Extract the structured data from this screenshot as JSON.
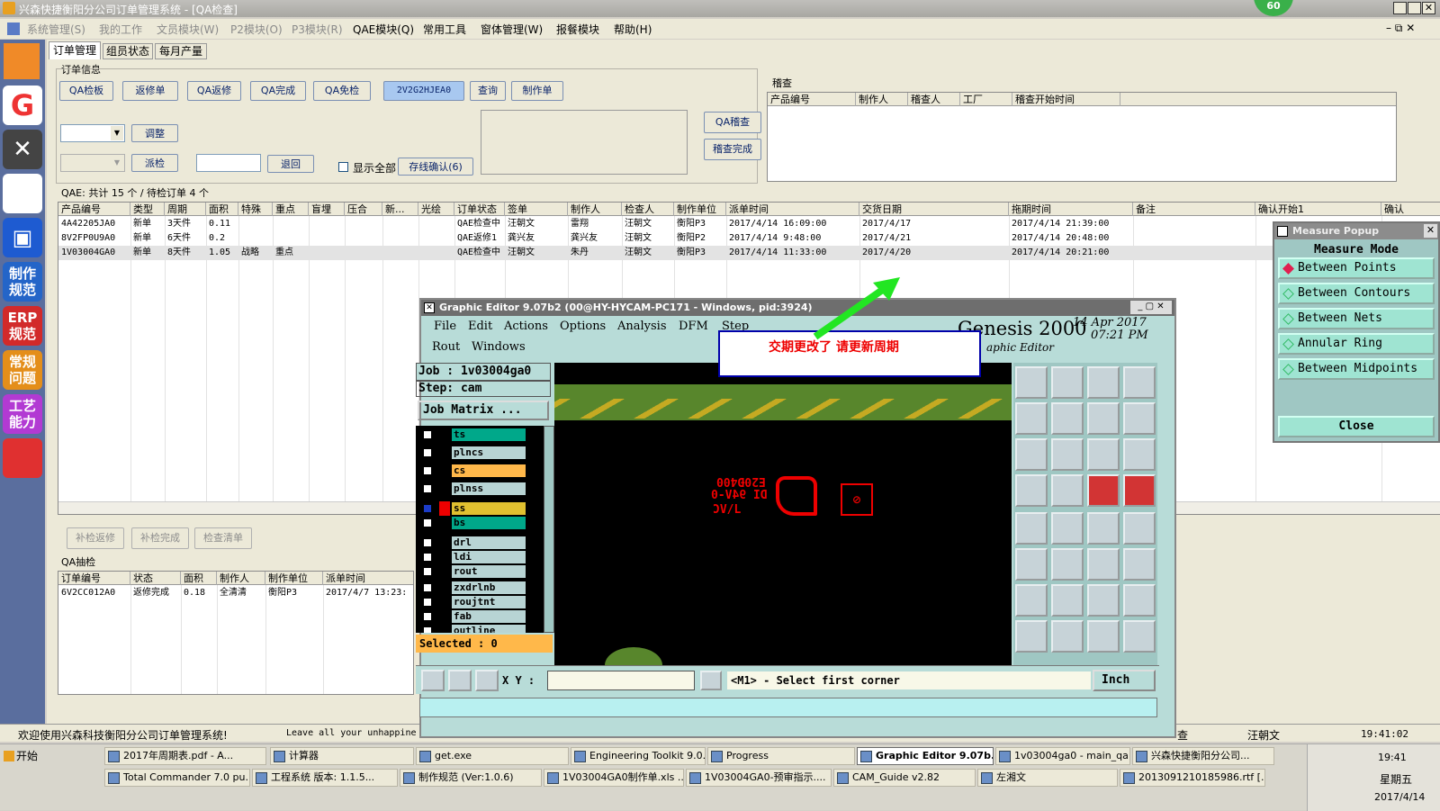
{
  "window": {
    "title": "兴森快捷衡阳分公司订单管理系统 - [QA检查]",
    "badge": "60"
  },
  "menubar": [
    "系统管理(S)",
    "我的工作",
    "文员模块(W)",
    "P2模块(O)",
    "P3模块(R)",
    "QAE模块(Q)",
    "常用工具",
    "窗体管理(W)",
    "报餐模块",
    "帮助(H)"
  ],
  "sidebar": {
    "labels": [
      "制作\n规范",
      "ERP\n规范",
      "常规\n问题",
      "工艺\n能力"
    ]
  },
  "tabs": [
    "订单管理",
    "组员状态",
    "每月产量"
  ],
  "order_info": {
    "group_label": "订单信息",
    "buttons_row1": [
      "QA检板",
      "返修单",
      "QA返修",
      "QA完成",
      "QA免检",
      "2V2G2HJEA0",
      "查询",
      "制作单"
    ],
    "adjust": "调整",
    "dispatch": "派检",
    "back": "退回",
    "show_all": "显示全部",
    "confirm": "存线确认(6)",
    "qa_audit": "QA稽查",
    "audit_done": "稽查完成"
  },
  "audit": {
    "label": "稽查",
    "headers": [
      "产品编号",
      "制作人",
      "稽查人",
      "工厂",
      "稽查开始时间"
    ]
  },
  "qae": {
    "summary": "QAE: 共计 15 个 / 待检订单 4 个",
    "headers": [
      "产品编号",
      "类型",
      "周期",
      "面积",
      "特殊",
      "重点",
      "盲埋",
      "压合",
      "新...",
      "光绘",
      "订单状态",
      "签单",
      "制作人",
      "检查人",
      "制作单位",
      "派单时间",
      "交货日期",
      "拖期时间",
      "备注",
      "确认开始1",
      "确认"
    ],
    "rows": [
      [
        "4A42205JA0",
        "新单",
        "3天件",
        "0.11",
        "",
        "",
        "",
        "",
        "",
        "",
        "QAE检查中",
        "汪朝文",
        "雷翔",
        "汪朝文",
        "衡阳P3",
        "2017/4/14 16:09:00",
        "2017/4/17",
        "2017/4/14 21:39:00",
        "",
        "",
        ""
      ],
      [
        "8V2FP0U9A0",
        "新单",
        "6天件",
        "0.2",
        "",
        "",
        "",
        "",
        "",
        "",
        "QAE返修1",
        "龚兴友",
        "龚兴友",
        "汪朝文",
        "衡阳P2",
        "2017/4/14 9:48:00",
        "2017/4/21",
        "2017/4/14 20:48:00",
        "",
        "",
        ""
      ],
      [
        "1V03004GA0",
        "新单",
        "8天件",
        "1.05",
        "战略",
        "重点",
        "",
        "",
        "",
        "",
        "QAE检查中",
        "汪朝文",
        "朱丹",
        "汪朝文",
        "衡阳P3",
        "2017/4/14 11:33:00",
        "2017/4/20",
        "2017/4/14 20:21:00",
        "",
        "",
        ""
      ]
    ]
  },
  "bottom": {
    "buttons": [
      "补检返修",
      "补检完成",
      "检查清单"
    ],
    "group_label": "QA抽检",
    "headers": [
      "订单编号",
      "状态",
      "面积",
      "制作人",
      "制作单位",
      "派单时间"
    ],
    "rows": [
      [
        "6V2CC012A0",
        "返修完成",
        "0.18",
        "全清清",
        "衡阳P3",
        "2017/4/7 13:23:"
      ]
    ]
  },
  "status": {
    "welcome": "欢迎使用兴森科技衡阳分公司订单管理系统!",
    "message": "Leave all your unhappine",
    "extra": "查",
    "user": "汪朝文",
    "time": "19:41:02"
  },
  "graphic_editor": {
    "title": "Graphic Editor 9.07b2 (00@HY-HYCAM-PC171 - Windows, pid:3924)",
    "menu": [
      "File",
      "Edit",
      "Actions",
      "Options",
      "Analysis",
      "DFM",
      "Step",
      "Rout",
      "Windows"
    ],
    "brand": "Genesis 2000",
    "date": "14 Apr  2017",
    "time": "07:21 PM",
    "sub": "aphic Editor",
    "job": "Job : 1v03004ga0",
    "step": "Step: cam",
    "job_matrix": "Job Matrix ...",
    "layers": [
      {
        "name": "ts",
        "color": "#00a88a"
      },
      {
        "name": "plncs",
        "color": "#b8d4d4"
      },
      {
        "name": "cs",
        "color": "#ffb84a"
      },
      {
        "name": "plnss",
        "color": "#b8d4d4"
      },
      {
        "name": "ss",
        "color": "#e0c030"
      },
      {
        "name": "bs",
        "color": "#00a88a"
      },
      {
        "name": "drl",
        "color": "#b8d4d4"
      },
      {
        "name": "ldi",
        "color": "#b8d4d4"
      },
      {
        "name": "rout",
        "color": "#b8d4d4"
      },
      {
        "name": "zxdrlnb",
        "color": "#b8d4d4"
      },
      {
        "name": "roujtnt",
        "color": "#b8d4d4"
      },
      {
        "name": "fab",
        "color": "#b8d4d4"
      },
      {
        "name": "outline",
        "color": "#b8d4d4"
      }
    ],
    "selected": "Selected : 0",
    "xy_label": "X Y :",
    "prompt": "<M1> - Select first corner",
    "unit": "Inch",
    "board_text1": "E20Ð400",
    "board_text2": "DI 94V-0",
    "board_text3": "ƆV/L",
    "callout": "交期更改了  请更新周期"
  },
  "measure_popup": {
    "title": "Measure Popup",
    "mode": "Measure Mode",
    "items": [
      "Between Points",
      "Between Contours",
      "Between Nets",
      "Annular Ring",
      "Between Midpoints"
    ],
    "close": "Close"
  },
  "taskbar": {
    "start": "开始",
    "row1": [
      "2017年周期表.pdf - A...",
      "计算器",
      "get.exe",
      "Engineering Toolkit 9.0...",
      "Progress",
      "Graphic Editor 9.07b...",
      "1v03004ga0 - main_qa",
      "兴森快捷衡阳分公司..."
    ],
    "row2": [
      "Total Commander 7.0 pu...",
      "工程系统  版本: 1.1.5...",
      "制作规范 (Ver:1.0.6)",
      "1V03004GA0制作单.xls ...",
      "1V03004GA0-预审指示....",
      "CAM_Guide v2.82",
      "左湘文",
      "2013091210185986.rtf [..."
    ],
    "clock": "19:41",
    "weekday": "星期五",
    "date": "2017/4/14"
  }
}
